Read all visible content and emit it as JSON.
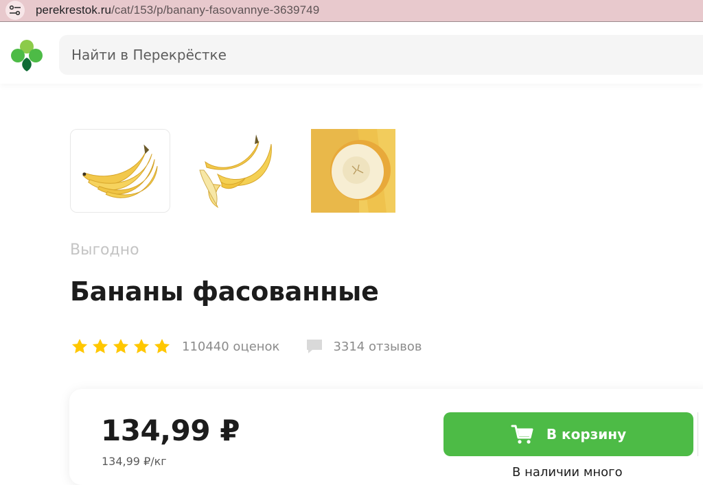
{
  "browser": {
    "url_domain": "perekrestok.ru",
    "url_path": "/cat/153/p/banany-fasovannye-3639749",
    "site_info_icon": "tune-icon"
  },
  "header": {
    "logo_icon": "clover-logo-icon",
    "search_placeholder": "Найти в Перекрёстке"
  },
  "gallery": {
    "thumbnails": [
      {
        "name": "banana-bunch",
        "active": true
      },
      {
        "name": "peeled-banana",
        "active": false
      },
      {
        "name": "banana-slice",
        "active": false
      }
    ]
  },
  "product": {
    "promo_label": "Выгодно",
    "title": "Бананы фасованные",
    "rating_stars": 5,
    "ratings_count": "110440 оценок",
    "reviews_count": "3314 отзывов"
  },
  "purchase": {
    "price": "134,99 ₽",
    "unit_price": "134,99 ₽/кг",
    "cart_button": "В корзину",
    "partial_text": "В наличии много"
  },
  "colors": {
    "accent_green": "#4dbb46",
    "star_yellow": "#ffc700",
    "address_bar": "#e8c9cd"
  }
}
